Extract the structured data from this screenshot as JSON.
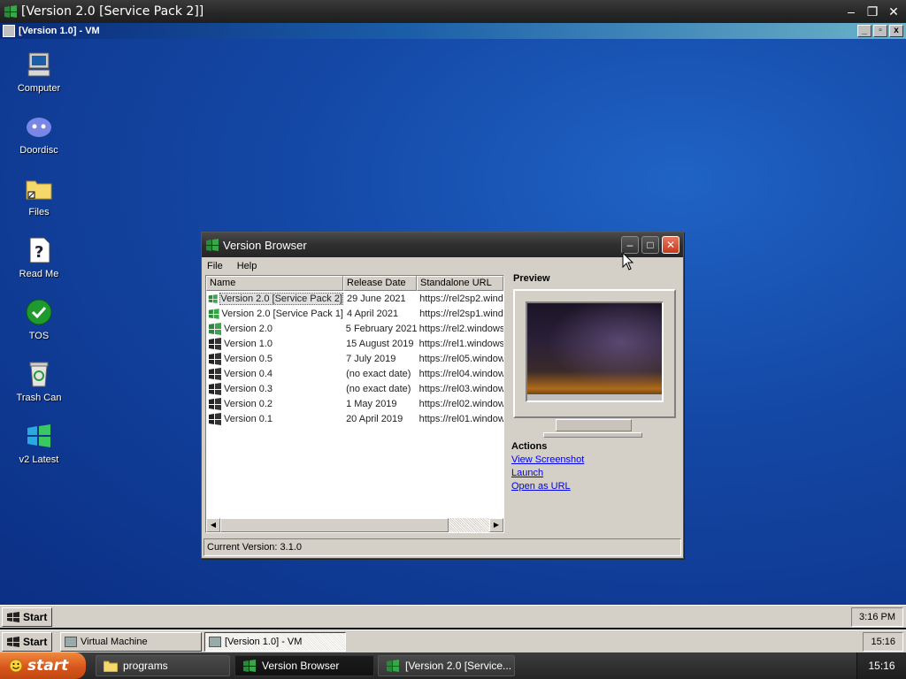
{
  "outer_window": {
    "title": "[Version 2.0 [Service Pack 2]]"
  },
  "vm_window": {
    "title": "[Version 1.0] - VM"
  },
  "desktop_icons": [
    {
      "label": "Computer",
      "icon": "computer-icon"
    },
    {
      "label": "Doordisc",
      "icon": "doordisc-icon"
    },
    {
      "label": "Files",
      "icon": "folder-icon"
    },
    {
      "label": "Read Me",
      "icon": "help-document-icon"
    },
    {
      "label": "TOS",
      "icon": "checkmark-icon"
    },
    {
      "label": "Trash Can",
      "icon": "trash-icon"
    },
    {
      "label": "v2 Latest",
      "icon": "windows-flag-icon"
    }
  ],
  "version_browser": {
    "title": "Version Browser",
    "menu": [
      "File",
      "Help"
    ],
    "columns": [
      "Name",
      "Release Date",
      "Standalone URL"
    ],
    "rows": [
      {
        "name": "Version 2.0 [Service Pack 2]",
        "date": "29 June 2021",
        "url": "https://rel2sp2.wind"
      },
      {
        "name": "Version 2.0 [Service Pack 1]",
        "date": "4 April 2021",
        "url": "https://rel2sp1.windo"
      },
      {
        "name": "Version 2.0",
        "date": "5 February 2021",
        "url": "https://rel2.windows"
      },
      {
        "name": "Version 1.0",
        "date": "15 August 2019",
        "url": "https://rel1.windows"
      },
      {
        "name": "Version 0.5",
        "date": "7 July 2019",
        "url": "https://rel05.window"
      },
      {
        "name": "Version 0.4",
        "date": "(no exact date)",
        "url": "https://rel04.window"
      },
      {
        "name": "Version 0.3",
        "date": "(no exact date)",
        "url": "https://rel03.window"
      },
      {
        "name": "Version 0.2",
        "date": "1 May 2019",
        "url": "https://rel02.window"
      },
      {
        "name": "Version 0.1",
        "date": "20 April 2019",
        "url": "https://rel01.window"
      }
    ],
    "preview_label": "Preview",
    "actions_label": "Actions",
    "actions": [
      "View Screenshot",
      "Launch",
      "Open as URL"
    ],
    "status": "Current Version: 3.1.0"
  },
  "taskbar_98_inner": {
    "start": "Start",
    "clock": "3:16 PM"
  },
  "taskbar_98_outer": {
    "start": "Start",
    "tasks": [
      "Virtual Machine",
      "[Version 1.0] - VM"
    ],
    "clock": "15:16"
  },
  "taskbar_xp": {
    "start": "start",
    "tasks": [
      "programs",
      "Version Browser",
      "[Version 2.0 [Service..."
    ],
    "clock": "15:16"
  },
  "colors": {
    "desktop": "#1448a6",
    "link": "#0000ee",
    "xp_start": "#d8561c"
  }
}
